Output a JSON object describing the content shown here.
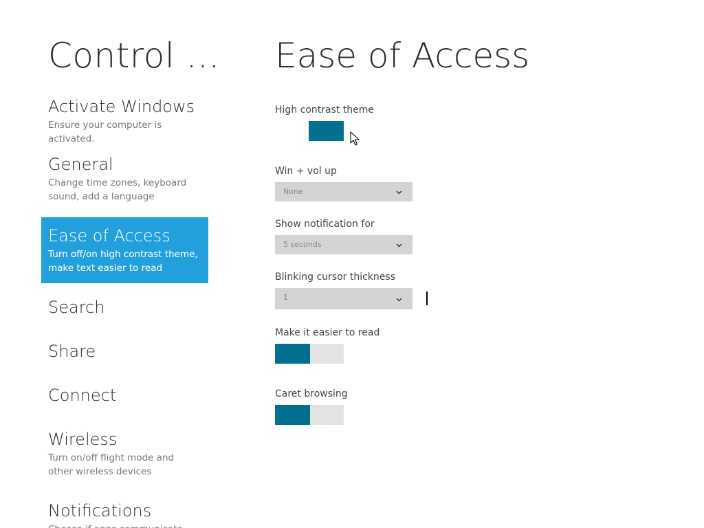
{
  "nav": {
    "title": "Control ...",
    "items": [
      {
        "label": "Activate Windows",
        "desc": "Ensure your computer is activated."
      },
      {
        "label": "General",
        "desc": "Change time zones, keyboard sound, add a language"
      },
      {
        "label": "Ease of Access",
        "desc": "Turn off/on high contrast theme, make text easier to read"
      },
      {
        "label": "Search"
      },
      {
        "label": "Share"
      },
      {
        "label": "Connect"
      },
      {
        "label": "Wireless",
        "desc": "Turn on/off flight mode and other wireless devices"
      },
      {
        "label": "Notifications",
        "desc": "Choose if apps communicate now"
      }
    ],
    "selected_index": 2
  },
  "main": {
    "title": "Ease of Access",
    "high_contrast": {
      "label": "High contrast theme",
      "on": true
    },
    "win_vol_up": {
      "label": "Win + vol up",
      "value": "None"
    },
    "notification": {
      "label": "Show notification for",
      "value": "5 seconds"
    },
    "cursor_thickness": {
      "label": "Blinking cursor thickness",
      "value": "1"
    },
    "easier_read": {
      "label": "Make it easier to read",
      "on": false
    },
    "caret_browsing": {
      "label": "Caret browsing",
      "on": false
    }
  },
  "colors": {
    "accent_selected": "#23a0dc",
    "toggle_on": "#04708f",
    "toggle_off": "#e3e3e3",
    "dropdown_bg": "#d4d4d4"
  },
  "icons": {
    "dropdown": "chevron-down-icon",
    "pointer": "mouse-pointer-icon",
    "caret": "text-caret-icon"
  }
}
